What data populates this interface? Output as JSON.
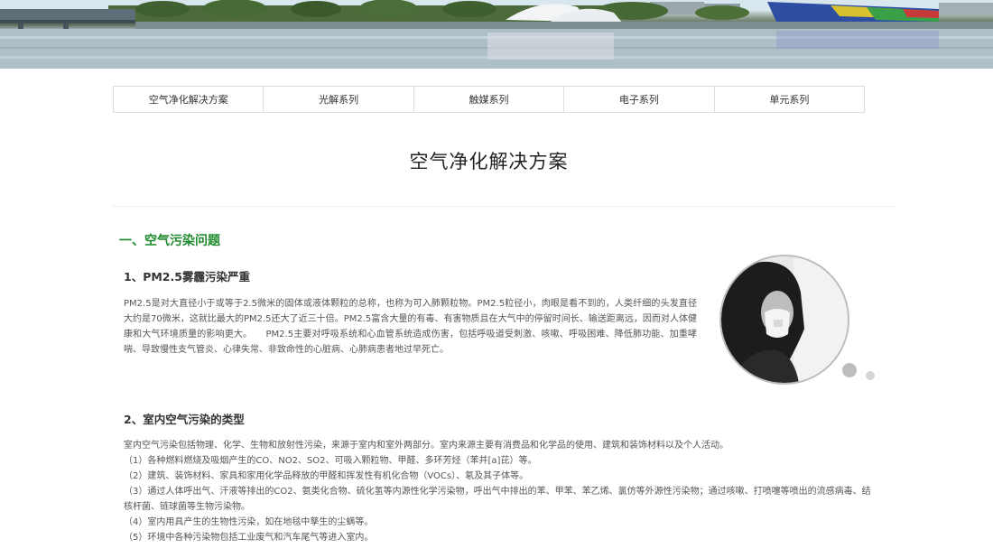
{
  "nav": {
    "items": [
      {
        "label": "空气净化解决方案"
      },
      {
        "label": "光解系列"
      },
      {
        "label": "触媒系列"
      },
      {
        "label": "电子系列"
      },
      {
        "label": "单元系列"
      }
    ]
  },
  "page": {
    "title": "空气净化解决方案"
  },
  "section1": {
    "heading": "一、空气污染问题",
    "sub1": {
      "heading": "1、PM2.5雾霾污染严重",
      "text": "PM2.5是对大直径小于或等于2.5微米的固体或液体颗粒的总称，也称为可入肺颗粒物。PM2.5粒径小，肉眼是看不到的，人类纤细的头发直径大约是70微米，这就比最大的PM2.5还大了近三十倍。PM2.5富含大量的有毒、有害物质且在大气中的停留时间长、输送距离远，因而对人体健康和大气环境质量的影响更大。　　PM2.5主要对呼吸系统和心血管系统造成伤害，包括呼吸道受刺激、咳嗽、呼吸困难、降低肺功能、加重哮喘、导致慢性支气管炎、心律失常、非致命性的心脏病、心肺病患者地过早死亡。"
    },
    "sub2": {
      "heading": "2、室内空气污染的类型",
      "lines": [
        "室内空气污染包括物理、化学、生物和放射性污染，来源于室内和室外两部分。室内来源主要有消费品和化学品的使用、建筑和装饰材料以及个人活动。",
        "（1）各种燃料燃烧及吸烟产生的CO、NO2、SO2、可吸入颗粒物、甲醛、多环芳烃（苯并[a]芘）等。",
        "（2）建筑、装饰材料、家具和家用化学品释放的甲醛和挥发性有机化合物（VOCs）、氡及其子体等。",
        "（3）通过人体呼出气、汗液等排出的CO2、氨类化合物、硫化氢等内源性化学污染物，呼出气中排出的苯、甲苯、苯乙烯、氯仿等外源性污染物；通过咳嗽、打喷嚏等喷出的流感病毒、结核杆菌、链球菌等生物污染物。",
        "（4）室内用具产生的生物性污染，如在地毯中孳生的尘螨等。",
        "（5）环境中各种污染物包括工业废气和汽车尾气等进入室内。"
      ]
    }
  },
  "colors": {
    "accent_green": "#1f8a2e",
    "border_gray": "#dcdcdc"
  },
  "icons": {
    "banner": "city-waterfront-image",
    "photo": "masked-person-photo"
  }
}
